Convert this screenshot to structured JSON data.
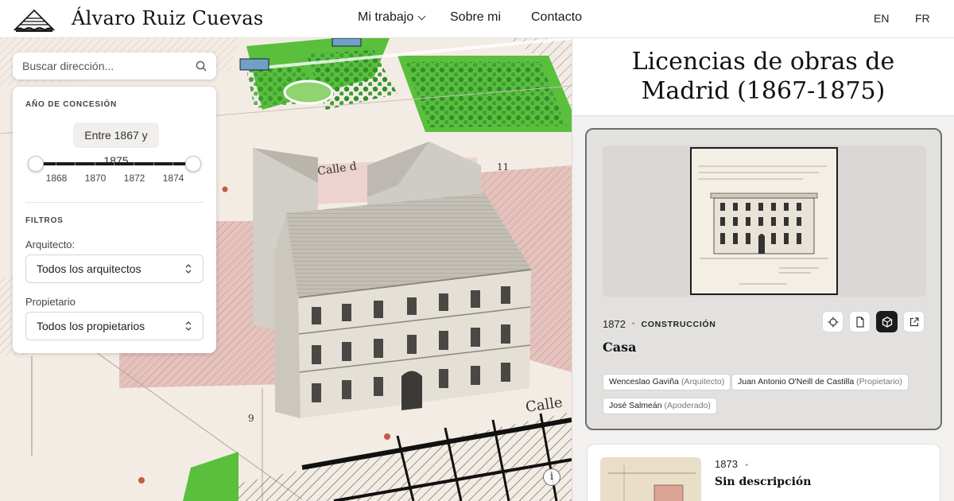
{
  "header": {
    "site_name": "Álvaro Ruiz Cuevas",
    "nav": {
      "mi_trabajo": "Mi trabajo",
      "sobre_mi": "Sobre mi",
      "contacto": "Contacto"
    },
    "langs": {
      "en": "EN",
      "fr": "FR"
    }
  },
  "search": {
    "placeholder": "Buscar dirección..."
  },
  "filters": {
    "year_section_title": "AÑO DE CONCESIÓN",
    "year_range_label": "Entre 1867 y 1875",
    "year_min": 1867,
    "year_max": 1875,
    "ticks": [
      "1868",
      "1870",
      "1872",
      "1874"
    ],
    "filters_section_title": "FILTROS",
    "architect_label": "Arquitecto:",
    "architect_value": "Todos los arquitectos",
    "owner_label": "Propietario",
    "owner_value": "Todos los propietarios"
  },
  "map": {
    "street_labels": [
      "Calle d",
      "Calle"
    ],
    "plot_numbers": [
      "9",
      "11"
    ],
    "info_button": "i"
  },
  "panel": {
    "title_line1": "Licencias de obras de",
    "title_line2": "Madrid (1867-1875)"
  },
  "cards": [
    {
      "year": "1872",
      "type": "CONSTRUCCIÓN",
      "title": "Casa",
      "selected": true,
      "people": [
        {
          "name": "Wenceslao Gaviña",
          "role": "(Arquitecto)"
        },
        {
          "name": "Juan Antonio O'Neill de Castilla",
          "role": "(Propietario)"
        },
        {
          "name": "José Salmeán",
          "role": "(Apoderado)"
        }
      ],
      "actions": [
        "locate-icon",
        "document-icon",
        "cube-icon",
        "external-link-icon"
      ],
      "active_action": "cube-icon"
    },
    {
      "year": "1873",
      "title": "Sin descripción",
      "selected": false
    }
  ],
  "colors": {
    "accent_dark": "#1b1b1b",
    "garden_green": "#55b93a",
    "plot_pink": "#d7a9a3",
    "map_bg": "#f3ece4"
  }
}
